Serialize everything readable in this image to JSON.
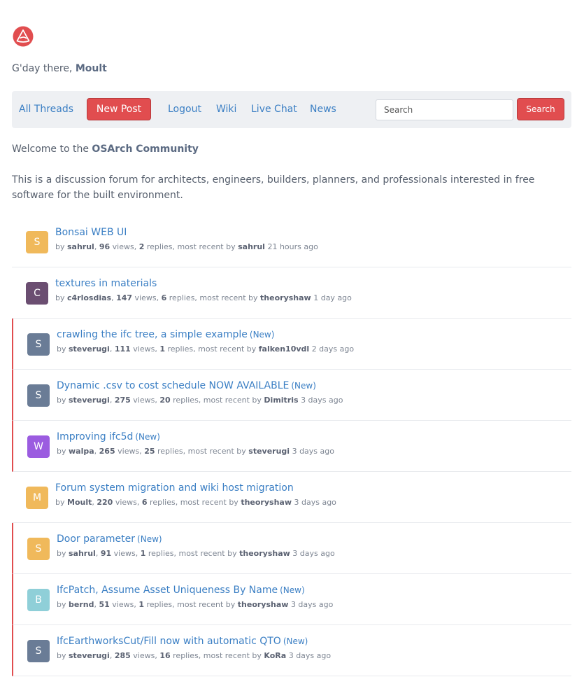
{
  "greeting": {
    "prefix": "G'day there, ",
    "user": "Moult"
  },
  "nav": {
    "all_threads": "All Threads",
    "new_post": "New Post",
    "logout": "Logout",
    "wiki": "Wiki",
    "live_chat": "Live Chat",
    "news": "News",
    "search_placeholder": "Search",
    "search_button": "Search"
  },
  "welcome": {
    "prefix": "Welcome to the ",
    "community": "OSArch Community"
  },
  "intro": "This is a discussion forum for architects, engineers, builders, planners, and professionals interested in free software for the built environment.",
  "colors": {
    "accent": "#e14d4f",
    "link": "#3b7fc4"
  },
  "threads": [
    {
      "title": "Bonsai WEB UI",
      "new": "",
      "is_new": false,
      "initial": "S",
      "avatar_color": "#f0b95b",
      "by_label": "by",
      "author": "sahrul",
      "views": "96",
      "views_label": " views, ",
      "replies": "2",
      "replies_label": " replies, most recent by ",
      "last_by": "sahrul",
      "ago": "21 hours ago"
    },
    {
      "title": "textures in materials",
      "new": "",
      "is_new": false,
      "initial": "C",
      "avatar_color": "#6b4e71",
      "by_label": "by",
      "author": "c4rlosdias",
      "views": "147",
      "views_label": " views, ",
      "replies": "6",
      "replies_label": " replies, most recent by ",
      "last_by": "theoryshaw",
      "ago": "1 day ago"
    },
    {
      "title": "crawling the ifc tree, a simple example",
      "new": "(New)",
      "is_new": true,
      "initial": "S",
      "avatar_color": "#6a7c96",
      "by_label": "by",
      "author": "steverugi",
      "views": "111",
      "views_label": " views, ",
      "replies": "1",
      "replies_label": " replies, most recent by ",
      "last_by": "falken10vdl",
      "ago": "2 days ago"
    },
    {
      "title": "Dynamic .csv to cost schedule NOW AVAILABLE",
      "new": "(New)",
      "is_new": true,
      "initial": "S",
      "avatar_color": "#6a7c96",
      "by_label": "by",
      "author": "steverugi",
      "views": "275",
      "views_label": " views, ",
      "replies": "20",
      "replies_label": " replies, most recent by ",
      "last_by": "Dimitris",
      "ago": "3 days ago"
    },
    {
      "title": "Improving ifc5d",
      "new": "(New)",
      "is_new": true,
      "initial": "W",
      "avatar_color": "#9b5ce0",
      "by_label": "by",
      "author": "walpa",
      "views": "265",
      "views_label": " views, ",
      "replies": "25",
      "replies_label": " replies, most recent by ",
      "last_by": "steverugi",
      "ago": "3 days ago"
    },
    {
      "title": "Forum system migration and wiki host migration",
      "new": "",
      "is_new": false,
      "initial": "M",
      "avatar_color": "#f0b95b",
      "by_label": "by",
      "author": "Moult",
      "views": "220",
      "views_label": " views, ",
      "replies": "6",
      "replies_label": " replies, most recent by ",
      "last_by": "theoryshaw",
      "ago": "3 days ago"
    },
    {
      "title": "Door parameter",
      "new": "(New)",
      "is_new": true,
      "initial": "S",
      "avatar_color": "#f0b95b",
      "by_label": "by",
      "author": "sahrul",
      "views": "91",
      "views_label": " views, ",
      "replies": "1",
      "replies_label": " replies, most recent by ",
      "last_by": "theoryshaw",
      "ago": "3 days ago"
    },
    {
      "title": "IfcPatch, Assume Asset Uniqueness By Name",
      "new": "(New)",
      "is_new": true,
      "initial": "B",
      "avatar_color": "#8fcfd8",
      "by_label": "by",
      "author": "bernd",
      "views": "51",
      "views_label": " views, ",
      "replies": "1",
      "replies_label": " replies, most recent by ",
      "last_by": "theoryshaw",
      "ago": "3 days ago"
    },
    {
      "title": "IfcEarthworksCut/Fill now with automatic QTO",
      "new": "(New)",
      "is_new": true,
      "initial": "S",
      "avatar_color": "#6a7c96",
      "by_label": "by",
      "author": "steverugi",
      "views": "285",
      "views_label": " views, ",
      "replies": "16",
      "replies_label": " replies, most recent by ",
      "last_by": "KoRa",
      "ago": "3 days ago"
    }
  ]
}
